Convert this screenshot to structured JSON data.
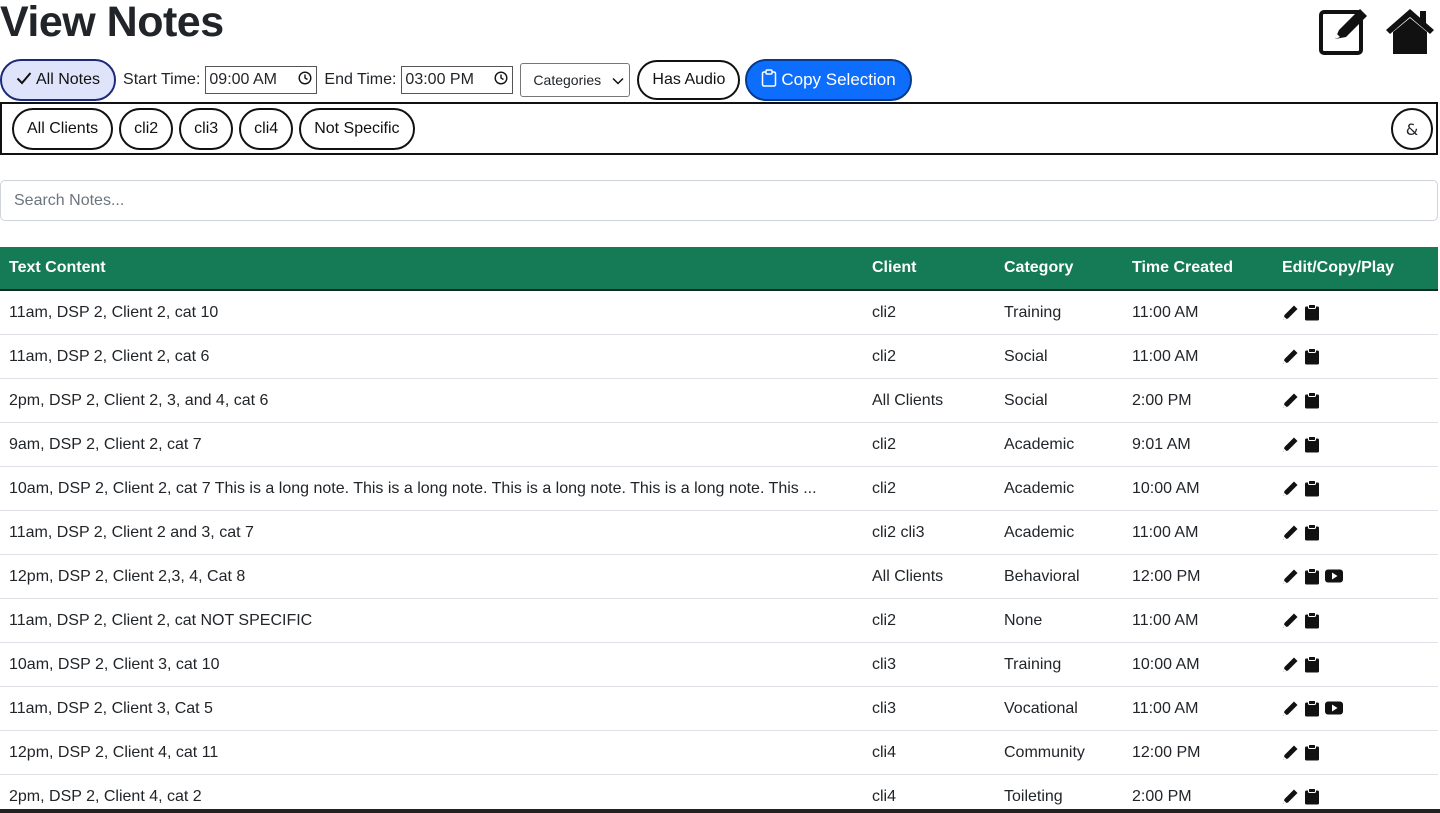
{
  "page": {
    "title": "View Notes"
  },
  "toolbar": {
    "all_notes_label": "All Notes",
    "start_time_label": "Start Time:",
    "start_time_value": "09:00 AM",
    "end_time_label": "End Time:",
    "end_time_value": "03:00 PM",
    "categories_label": "Categories",
    "has_audio_label": "Has Audio",
    "copy_selection_label": "Copy Selection"
  },
  "clients": {
    "chips": [
      "All Clients",
      "cli2",
      "cli3",
      "cli4",
      "Not Specific"
    ],
    "amp_label": "&"
  },
  "search": {
    "placeholder": "Search Notes..."
  },
  "table": {
    "headers": [
      "Text Content",
      "Client",
      "Category",
      "Time Created",
      "Edit/Copy/Play"
    ],
    "rows": [
      {
        "text": "11am, DSP 2, Client 2, cat 10",
        "client": "cli2",
        "category": "Training",
        "time": "11:00 AM",
        "audio": false
      },
      {
        "text": "11am, DSP 2, Client 2, cat 6",
        "client": "cli2",
        "category": "Social",
        "time": "11:00 AM",
        "audio": false
      },
      {
        "text": "2pm, DSP 2, Client 2, 3, and 4, cat 6",
        "client": "All Clients",
        "category": "Social",
        "time": "2:00 PM",
        "audio": false
      },
      {
        "text": "9am, DSP 2, Client 2, cat 7",
        "client": "cli2",
        "category": "Academic",
        "time": "9:01 AM",
        "audio": false
      },
      {
        "text": "10am, DSP 2, Client 2, cat 7 This is a long note. This is a long note. This is a long note. This is a long note. This ...",
        "client": "cli2",
        "category": "Academic",
        "time": "10:00 AM",
        "audio": false
      },
      {
        "text": "11am, DSP 2, Client 2 and 3, cat 7",
        "client": "cli2 cli3",
        "category": "Academic",
        "time": "11:00 AM",
        "audio": false
      },
      {
        "text": "12pm, DSP 2, Client 2,3, 4, Cat 8",
        "client": "All Clients",
        "category": "Behavioral",
        "time": "12:00 PM",
        "audio": true
      },
      {
        "text": "11am, DSP 2, Client 2, cat NOT SPECIFIC",
        "client": "cli2",
        "category": "None",
        "time": "11:00 AM",
        "audio": false
      },
      {
        "text": "10am, DSP 2, Client 3, cat 10",
        "client": "cli3",
        "category": "Training",
        "time": "10:00 AM",
        "audio": false
      },
      {
        "text": "11am, DSP 2, Client 3, Cat 5",
        "client": "cli3",
        "category": "Vocational",
        "time": "11:00 AM",
        "audio": true
      },
      {
        "text": "12pm, DSP 2, Client 4, cat 11",
        "client": "cli4",
        "category": "Community",
        "time": "12:00 PM",
        "audio": false
      },
      {
        "text": "2pm, DSP 2, Client 4, cat 2",
        "client": "cli4",
        "category": "Toileting",
        "time": "2:00 PM",
        "audio": false
      }
    ]
  },
  "icons": {
    "top": [
      "edit-note-icon",
      "home-icon"
    ],
    "row_actions": [
      "pencil-icon",
      "clipboard-icon",
      "play-icon"
    ]
  },
  "colors": {
    "header_green": "#157a56",
    "primary_blue": "#0d6efd",
    "active_pill_bg": "#dfe4fb"
  }
}
